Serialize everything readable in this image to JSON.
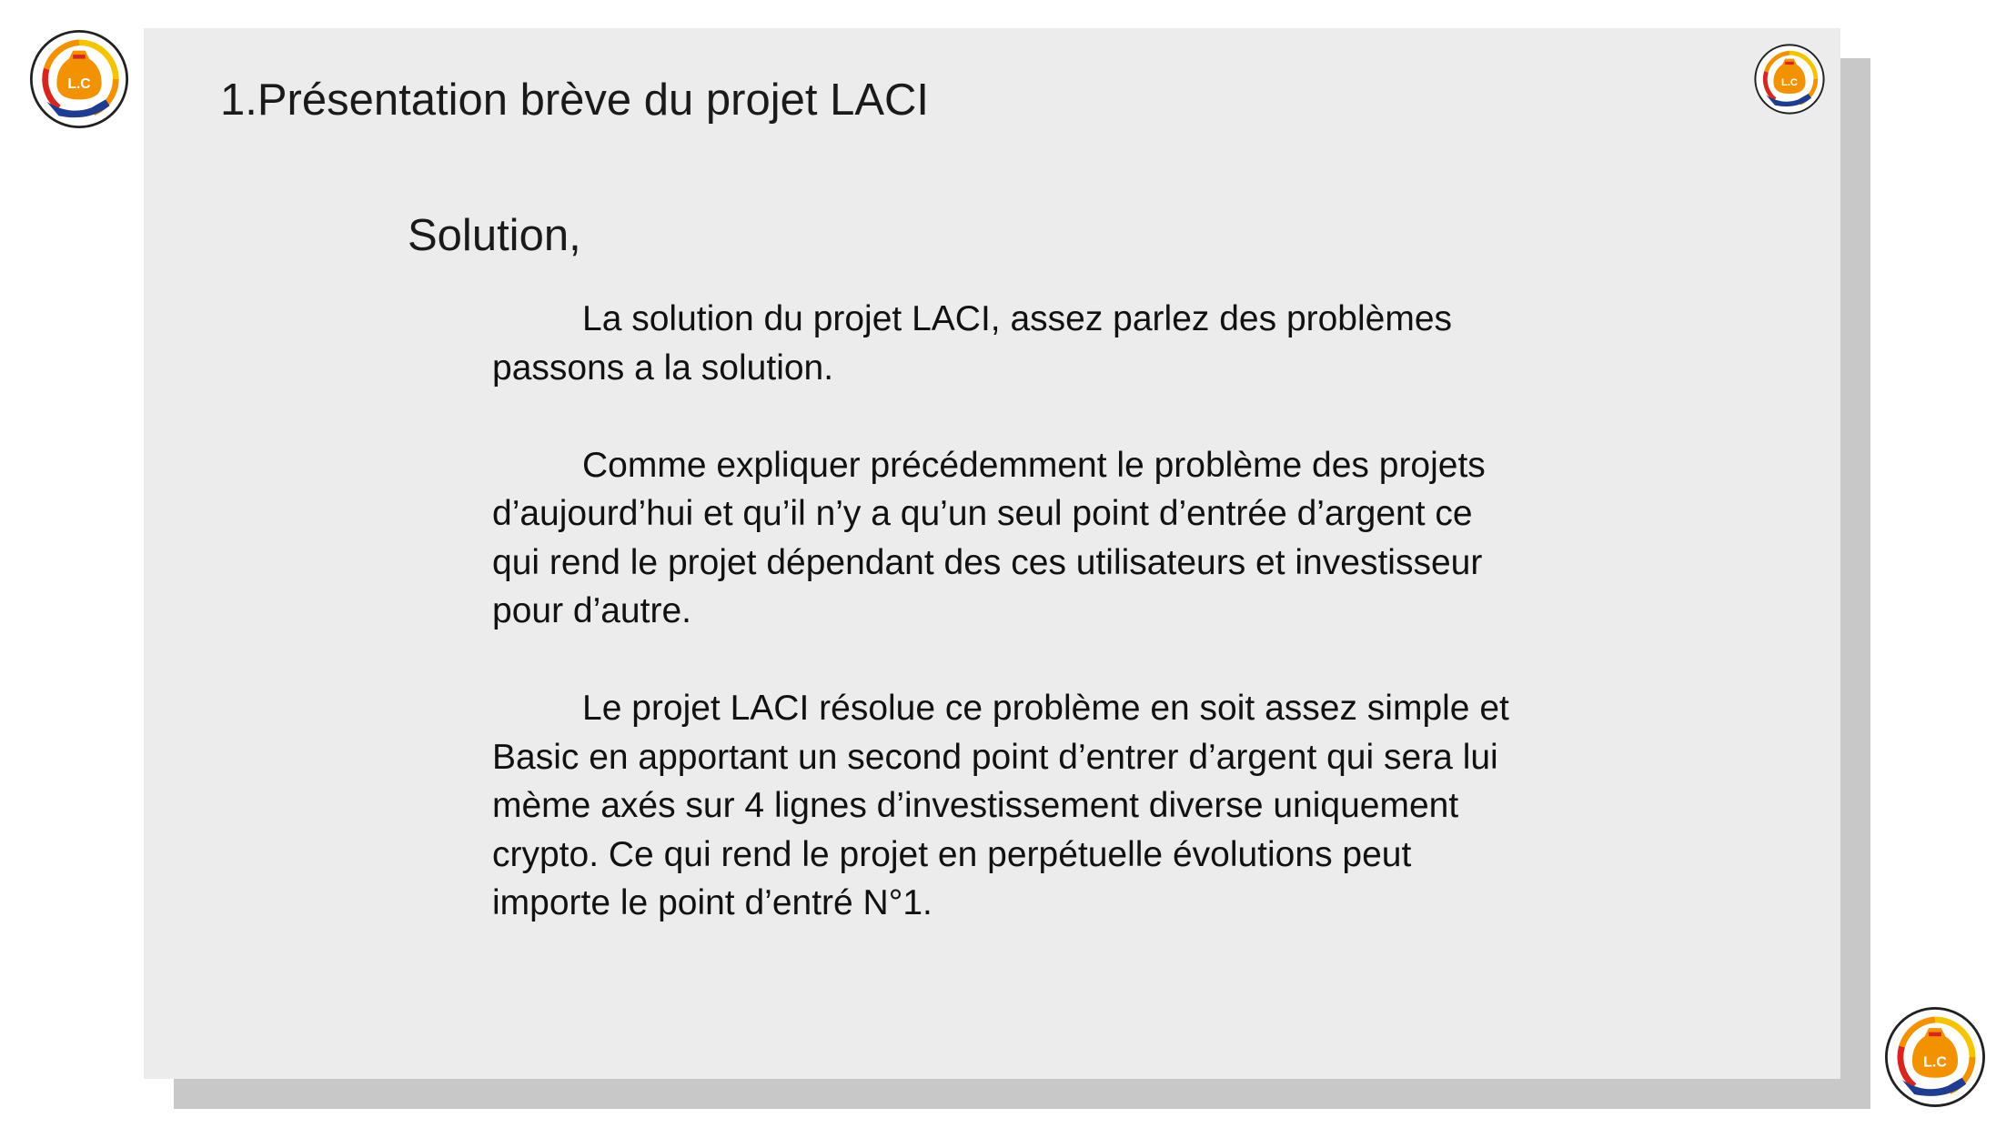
{
  "slide": {
    "title": "1.Présentation brève du projet LACI",
    "subtitle": "Solution,",
    "paragraphs": [
      "La solution du projet LACI, assez parlez des problèmes passons a la solution.",
      "Comme expliquer précédemment le problème des projets d’aujourd’hui et qu’il n’y a qu’un seul point d’entrée d’argent ce qui rend le projet dépendant des ces utilisateurs et investisseur pour d’autre.",
      "Le projet LACI résolue ce problème en soit assez simple et Basic en apportant un second point d’entrer d’argent qui sera lui mème axés sur 4 lignes d’investissement diverse uniquement crypto. Ce qui rend le projet en perpétuelle évolutions peut importe le point d’entré N°1."
    ]
  },
  "logo": {
    "text": "L.C",
    "icon": "laci-coin-bag-logo",
    "colors": {
      "orange": "#f39200",
      "yellow": "#f5c400",
      "red": "#d7261e",
      "navy": "#1f3c8f",
      "ring": "#222222"
    }
  },
  "colors": {
    "slide_background": "#ececec",
    "shadow": "#c8c8c8",
    "text": "#111111"
  }
}
